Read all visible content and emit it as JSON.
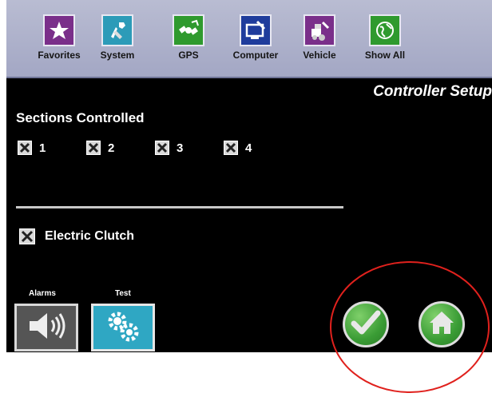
{
  "toolbar": {
    "items": [
      {
        "label": "Favorites",
        "icon": "star-icon",
        "color": "#7a2f8a"
      },
      {
        "label": "System",
        "icon": "system-tools-icon",
        "color": "#2c9bb8"
      },
      {
        "label": "GPS",
        "icon": "satellite-icon",
        "color": "#2f9a2e"
      },
      {
        "label": "Computer",
        "icon": "computer-icon",
        "color": "#1f3c9c"
      },
      {
        "label": "Vehicle",
        "icon": "vehicle-icon",
        "color": "#7a2f8a"
      },
      {
        "label": "Show All",
        "icon": "globe-icon",
        "color": "#2f9a2e"
      }
    ]
  },
  "page": {
    "title": "Controller Setup"
  },
  "sections": {
    "label": "Sections Controlled",
    "items": [
      "1",
      "2",
      "3",
      "4"
    ]
  },
  "clutch": {
    "label": "Electric Clutch",
    "checked": true
  },
  "buttons": {
    "alarms_label": "Alarms",
    "test_label": "Test"
  },
  "colors": {
    "highlight": "#e0211d",
    "accept": "#3a9c35",
    "background": "#000000"
  }
}
